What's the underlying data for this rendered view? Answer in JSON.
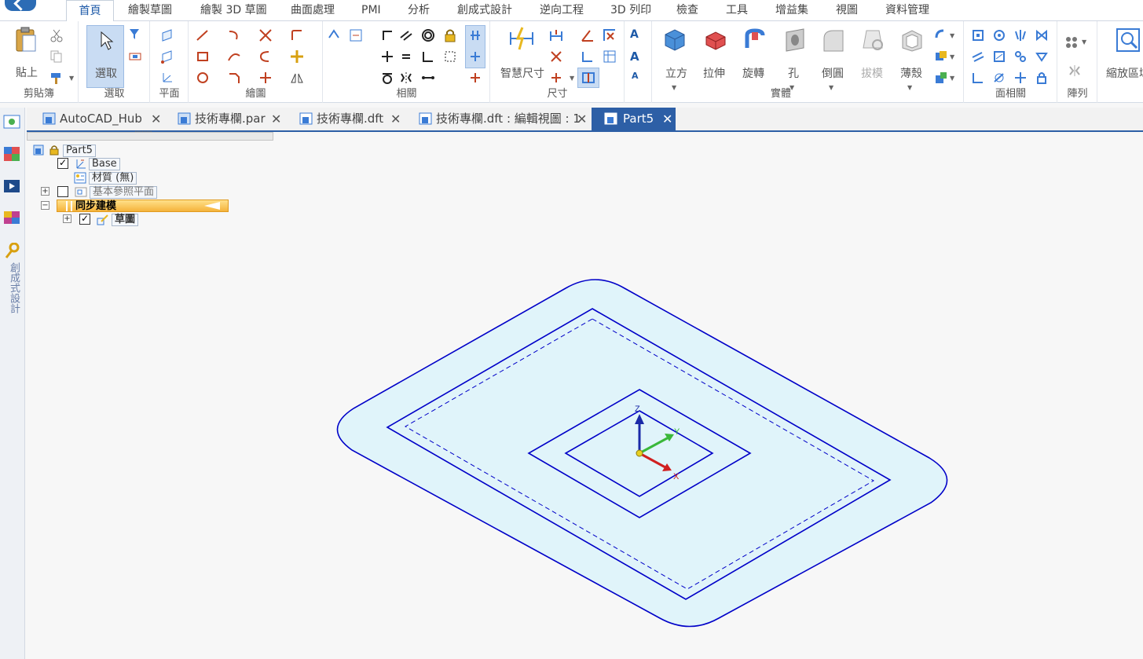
{
  "ribbon_tabs": [
    "首頁",
    "繪製草圖",
    "繪製 3D 草圖",
    "曲面處理",
    "PMI",
    "分析",
    "創成式設計",
    "逆向工程",
    "3D 列印",
    "檢查",
    "工具",
    "增益集",
    "視圖",
    "資料管理"
  ],
  "ribbon_groups": {
    "clipboard": {
      "label": "剪貼簿",
      "paste": "貼上"
    },
    "select": {
      "label": "選取",
      "select": "選取"
    },
    "plane": {
      "label": "平面"
    },
    "draw": {
      "label": "繪圖"
    },
    "relate": {
      "label": "相關"
    },
    "dimension": {
      "label": "尺寸",
      "smart": "智慧尺寸"
    },
    "solids": {
      "label": "實體",
      "cube": "立方",
      "extrude": "拉伸",
      "revolve": "旋轉",
      "hole": "孔",
      "round": "倒圓",
      "draft": "拔模",
      "thin": "薄殼"
    },
    "face_relate": {
      "label": "面相關"
    },
    "pattern": {
      "label": "陣列"
    },
    "zoom": {
      "label": "縮放區域"
    }
  },
  "doc_tabs": [
    "AutoCAD_Hub",
    "技術專欄.par",
    "技術專欄.dft",
    "技術專欄.dft : 編輯視圖 : 1",
    "Part5"
  ],
  "left_strip": {
    "generative_label": "創成式設計"
  },
  "tree": {
    "root": "Part5",
    "base": "Base",
    "material": "材質 (無)",
    "ref_planes": "基本參照平面",
    "sync": "同步建模",
    "sketch": "草圖"
  },
  "triad": {
    "z": "Z",
    "y": "Y",
    "x": "X"
  },
  "colors": {
    "accent": "#2d5fa6",
    "sketch_line": "#0000c8",
    "region_fill": "#e0f4fa"
  }
}
